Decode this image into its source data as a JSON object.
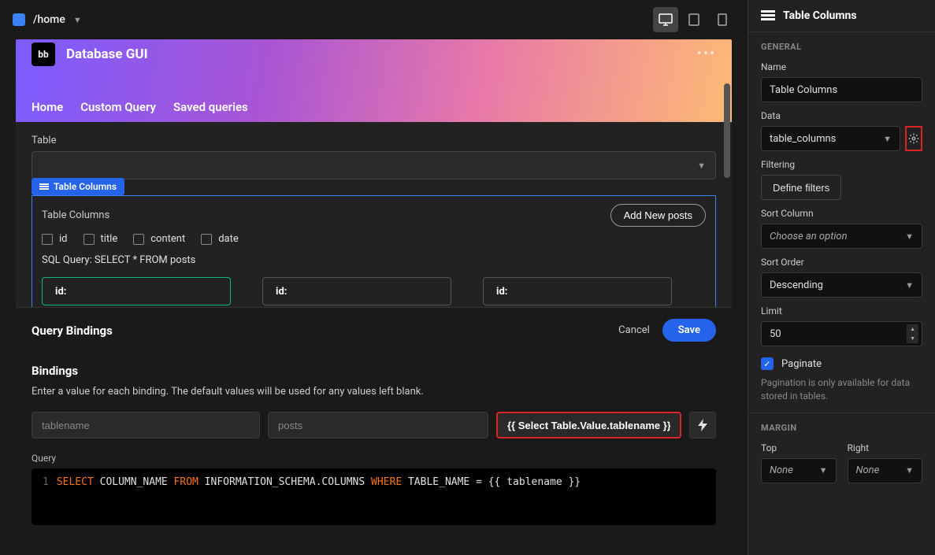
{
  "topbar": {
    "breadcrumb": "/home"
  },
  "preview": {
    "app_title": "Database GUI",
    "logo_text": "bb",
    "tabs": [
      "Home",
      "Custom Query",
      "Saved queries"
    ],
    "table_label": "Table",
    "component_tag": "Table Columns",
    "columns_title": "Table Columns",
    "checks": [
      "id",
      "title",
      "content",
      "date"
    ],
    "add_btn": "Add New posts",
    "sql_line": "SQL Query: SELECT * FROM posts",
    "card_label": "id:"
  },
  "bindings": {
    "panel_title": "Query Bindings",
    "cancel": "Cancel",
    "save": "Save",
    "section_title": "Bindings",
    "help": "Enter a value for each binding. The default values will be used for any values left blank.",
    "input1_placeholder": "tablename",
    "input2_placeholder": "posts",
    "input3_value": "{{ Select Table.Value.tablename }}",
    "query_label": "Query",
    "code": {
      "line_no": "1",
      "k1": "SELECT",
      "c1": " COLUMN_NAME ",
      "k2": "FROM",
      "c2": " INFORMATION_SCHEMA.COLUMNS ",
      "k3": "WHERE",
      "c3": " TABLE_NAME = {{ tablename }}"
    }
  },
  "sidebar": {
    "header": "Table Columns",
    "general": {
      "title": "GENERAL",
      "name_label": "Name",
      "name_value": "Table Columns",
      "data_label": "Data",
      "data_value": "table_columns",
      "filtering_label": "Filtering",
      "filter_btn": "Define filters",
      "sortcol_label": "Sort Column",
      "sortcol_value": "Choose an option",
      "sortorder_label": "Sort Order",
      "sortorder_value": "Descending",
      "limit_label": "Limit",
      "limit_value": "50",
      "paginate_label": "Paginate",
      "paginate_help": "Pagination is only available for data stored in tables."
    },
    "margin": {
      "title": "MARGIN",
      "top_label": "Top",
      "right_label": "Right",
      "none": "None"
    }
  }
}
